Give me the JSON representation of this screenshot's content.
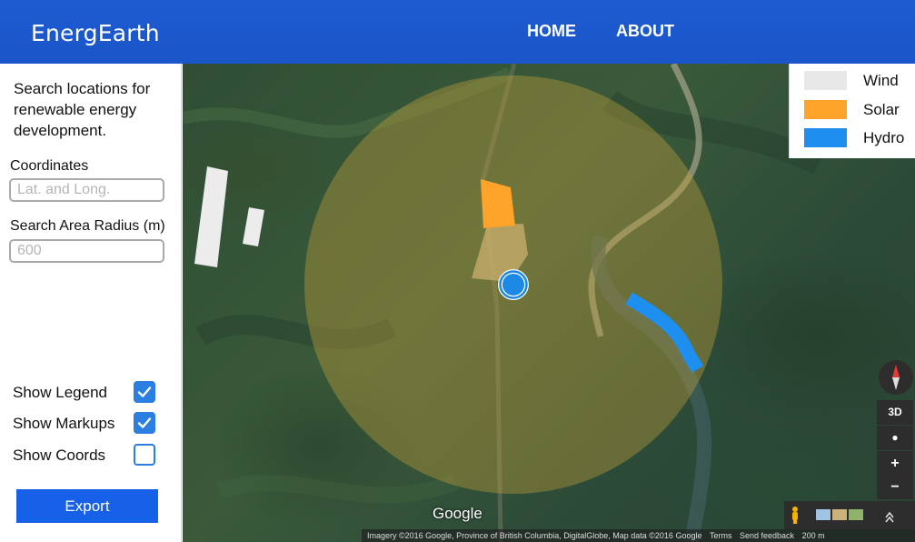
{
  "app": {
    "title": "EnergEarth",
    "nav": [
      {
        "label": "HOME"
      },
      {
        "label": "ABOUT"
      }
    ]
  },
  "sidebar": {
    "intro": "Search locations for renewable energy development.",
    "coordinates": {
      "label": "Coordinates",
      "placeholder": "Lat. and Long.",
      "value": ""
    },
    "radius": {
      "label": "Search Area Radius (m)",
      "placeholder": "600",
      "value": ""
    },
    "toggles": [
      {
        "label": "Show Legend",
        "checked": true
      },
      {
        "label": "Show Markups",
        "checked": true
      },
      {
        "label": "Show Coords",
        "checked": false
      }
    ],
    "export_label": "Export"
  },
  "legend": {
    "items": [
      {
        "label": "Wind",
        "color": "#e8e8e8"
      },
      {
        "label": "Solar",
        "color": "#ffa32a"
      },
      {
        "label": "Hydro",
        "color": "#1e8fef"
      }
    ]
  },
  "map": {
    "search_area_color": "#c9a23a",
    "marker_color": "#1e88e5",
    "google_logo": "Google",
    "controls": {
      "three_d": "3D",
      "zoom_in": "+",
      "zoom_out": "−"
    },
    "attribution": [
      "Imagery ©2016 Google, Province of British Columbia, DigitalGlobe, Map data ©2016 Google",
      "Terms",
      "Send feedback",
      "200 m"
    ]
  }
}
